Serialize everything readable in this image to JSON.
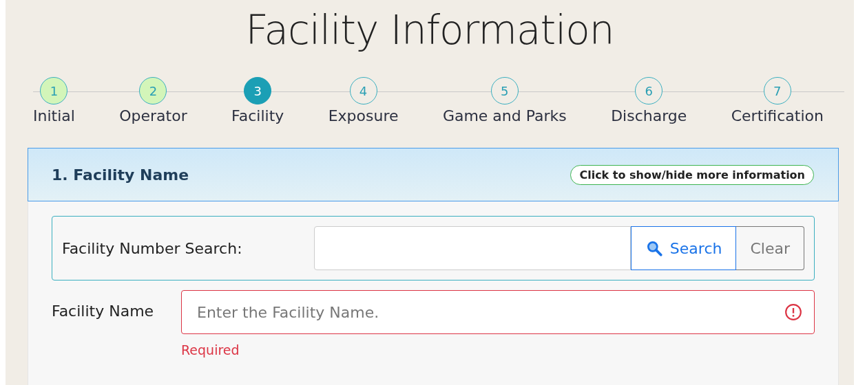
{
  "title": "Facility Information",
  "steps": [
    {
      "number": "1",
      "label": "Initial",
      "completed": true,
      "selected": false
    },
    {
      "number": "2",
      "label": "Operator",
      "completed": true,
      "selected": false
    },
    {
      "number": "3",
      "label": "Facility",
      "completed": false,
      "selected": true
    },
    {
      "number": "4",
      "label": "Exposure",
      "completed": false,
      "selected": false
    },
    {
      "number": "5",
      "label": "Game and Parks",
      "completed": false,
      "selected": false
    },
    {
      "number": "6",
      "label": "Discharge",
      "completed": false,
      "selected": false
    },
    {
      "number": "7",
      "label": "Certification",
      "completed": false,
      "selected": false
    }
  ],
  "section": {
    "title": "1. Facility Name",
    "info_button": "Click to show/hide more information"
  },
  "search": {
    "label": "Facility Number Search:",
    "search_button": "Search",
    "clear_button": "Clear"
  },
  "facility_name": {
    "label": "Facility Name",
    "placeholder": "Enter the Facility Name.",
    "invalid": true,
    "error": "Required"
  }
}
